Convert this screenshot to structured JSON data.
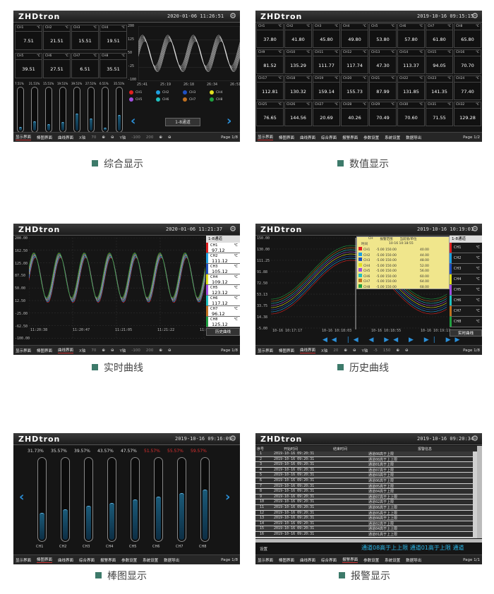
{
  "brand": "ZHDtron",
  "nav_tabs": [
    "显示界面",
    "棒图界面",
    "曲线界面",
    "综合界面",
    "报警界面",
    "参数设置",
    "系统设置",
    "数据导出"
  ],
  "panels": {
    "p1": {
      "caption": "综合显示",
      "datetime": "2020-01-06  11:26:51",
      "channels": [
        {
          "name": "CH1",
          "unit": "℃",
          "value": "7.51"
        },
        {
          "name": "CH2",
          "unit": "℃",
          "value": "21.51"
        },
        {
          "name": "CH3",
          "unit": "℃",
          "value": "15.51"
        },
        {
          "name": "CH4",
          "unit": "℃",
          "value": "19.51"
        },
        {
          "name": "CH5",
          "unit": "℃",
          "value": "39.51"
        },
        {
          "name": "CH6",
          "unit": "℃",
          "value": "27.51"
        },
        {
          "name": "CH7",
          "unit": "℃",
          "value": "6.51"
        },
        {
          "name": "CH8",
          "unit": "℃",
          "value": "35.51"
        }
      ],
      "bar_pcts": [
        "7.51%",
        "21.51%",
        "15.51%",
        "19.51%",
        "39.51%",
        "27.51%",
        "6.51%",
        "35.51%"
      ],
      "yticks": [
        "200",
        "125",
        "50",
        "-25",
        "-100"
      ],
      "xticks": [
        "25:41",
        "25:19",
        "26:18",
        "26:34",
        "26:51"
      ],
      "legend": [
        "CH1",
        "CH2",
        "CH3",
        "CH4",
        "CH5",
        "CH6",
        "CH7",
        "CH8"
      ],
      "group": "1-8通道",
      "footer": {
        "x": "X轴",
        "x_val": "70",
        "y": "Y轴",
        "y_min": "-100",
        "y_max": "200",
        "page": "Page 1/8"
      }
    },
    "p2": {
      "caption": "数值显示",
      "datetime": "2019-10-16  09:15:15",
      "rows": [
        [
          [
            "CH1",
            "37.80"
          ],
          [
            "CH2",
            "41.80"
          ],
          [
            "CH3",
            "45.80"
          ],
          [
            "CH4",
            "49.80"
          ],
          [
            "CH5",
            "53.80"
          ],
          [
            "CH6",
            "57.80"
          ],
          [
            "CH7",
            "61.80"
          ],
          [
            "CH8",
            "65.80"
          ]
        ],
        [
          [
            "CH9",
            "81.52"
          ],
          [
            "CH10",
            "135.29"
          ],
          [
            "CH11",
            "111.77"
          ],
          [
            "CH12",
            "117.74"
          ],
          [
            "CH13",
            "47.30"
          ],
          [
            "CH14",
            "113.37"
          ],
          [
            "CH15",
            "94.05"
          ],
          [
            "CH16",
            "70.70"
          ]
        ],
        [
          [
            "CH17",
            "112.81"
          ],
          [
            "CH18",
            "130.32"
          ],
          [
            "CH19",
            "159.14"
          ],
          [
            "CH20",
            "155.73"
          ],
          [
            "CH21",
            "87.99"
          ],
          [
            "CH22",
            "131.85"
          ],
          [
            "CH23",
            "141.35"
          ],
          [
            "CH24",
            "77.40"
          ]
        ],
        [
          [
            "CH25",
            "76.65"
          ],
          [
            "CH26",
            "144.56"
          ],
          [
            "CH27",
            "20.69"
          ],
          [
            "CH28",
            "40.26"
          ],
          [
            "CH29",
            "70.49"
          ],
          [
            "CH30",
            "70.60"
          ],
          [
            "CH31",
            "71.55"
          ],
          [
            "CH32",
            "129.28"
          ]
        ]
      ],
      "unit": "℃",
      "page": "Page 1/2"
    },
    "p3": {
      "caption": "实时曲线",
      "datetime": "2020-01-06  11:21:37",
      "yticks": [
        "200.00",
        "162.50",
        "125.00",
        "87.50",
        "50.00",
        "12.50",
        "-25.00",
        "-62.50",
        "-100.00"
      ],
      "xticks": [
        "11:20:38",
        "11:20:47",
        "11:21:05",
        "11:21:22",
        "11:21:40"
      ],
      "group": "1-8通道",
      "channels": [
        {
          "name": "CH1",
          "value": "97.12",
          "color": "#e02020"
        },
        {
          "name": "CH2",
          "value": "111.12",
          "color": "#20a0e0"
        },
        {
          "name": "CH3",
          "value": "105.12",
          "color": "#2050c0"
        },
        {
          "name": "CH4",
          "value": "109.12",
          "color": "#e0e020"
        },
        {
          "name": "CH5",
          "value": "123.12",
          "color": "#a050e0"
        },
        {
          "name": "CH6",
          "value": "117.12",
          "color": "#20c0c0"
        },
        {
          "name": "CH7",
          "value": "96.12",
          "color": "#c07020"
        },
        {
          "name": "CH8",
          "value": "125.12",
          "color": "#20a040"
        }
      ],
      "unit": "℃",
      "hist_btn": "历史曲线",
      "footer": {
        "x": "X轴",
        "x_val": "70",
        "y": "Y轴",
        "y_min": "-100",
        "y_max": "200",
        "page": "Page 1/8"
      }
    },
    "p4": {
      "caption": "历史曲线",
      "datetime": "2019-10-16  10:19:01",
      "yticks": [
        "150.00",
        "130.00",
        "111.25",
        "91.88",
        "72.50",
        "53.13",
        "33.75",
        "14.38",
        "-5.00"
      ],
      "table_head": [
        "",
        "CH",
        "报警范围",
        "当前值/单位"
      ],
      "table_sub": [
        "时间",
        "10-16 10:18:55"
      ],
      "table_rows": [
        [
          "CH1",
          "-5.00 150.00",
          "40.00"
        ],
        [
          "CH2",
          "-5.00 150.00",
          "44.00"
        ],
        [
          "CH3",
          "-5.00 150.00",
          "48.00"
        ],
        [
          "CH4",
          "-5.00 150.00",
          "52.00"
        ],
        [
          "CH5",
          "-5.00 150.00",
          "56.00"
        ],
        [
          "CH6",
          "-5.00 150.00",
          "60.00"
        ],
        [
          "CH7",
          "-5.00 150.00",
          "64.00"
        ],
        [
          "CH8",
          "-5.00 150.00",
          "68.00"
        ]
      ],
      "row_colors": [
        "#e02020",
        "#20a0e0",
        "#2050c0",
        "#e0e020",
        "#a050e0",
        "#20c0c0",
        "#c07020",
        "#20a040"
      ],
      "xticks": [
        "10-16 10:17:17",
        "10-16 10:18:03",
        "10-16 10:18:55",
        "10-16 10:19:17"
      ],
      "group": "1-8通道",
      "chs": [
        "CH1",
        "CH2",
        "CH3",
        "CH4",
        "CH5",
        "CH6",
        "CH7",
        "CH8"
      ],
      "unit": "℃",
      "hist_btn": "实时曲线",
      "footer": {
        "x": "X轴",
        "x_val": "20",
        "y": "Y轴",
        "y_min": "-5",
        "y_max": "150",
        "page": "Page 1/8"
      }
    },
    "p5": {
      "caption": "棒图显示",
      "datetime": "2019-10-16  09:16:09",
      "pcts": [
        "31.73%",
        "35.57%",
        "39.57%",
        "43.57%",
        "47.57%",
        "51.57%",
        "55.57%",
        "59.57%"
      ],
      "over_color": "#e03030",
      "names": [
        "CH1",
        "CH2",
        "CH3",
        "CH4",
        "CH5",
        "CH6",
        "CH7",
        "CH8"
      ],
      "levels": [
        0.33,
        0.37,
        0.41,
        0.45,
        0.49,
        0.53,
        0.57,
        0.61
      ],
      "page": "Page 1/8"
    },
    "p6": {
      "caption": "报警显示",
      "datetime": "2019-10-16  09:20:34",
      "head": [
        "序号",
        "开始时间",
        "结束时间",
        "报警信息"
      ],
      "rows": [
        [
          "1",
          "2019-10-16 09:20:31",
          "",
          "通道08高于上限"
        ],
        [
          "2",
          "2019-10-16 09:20:31",
          "",
          "通道08高于上上限"
        ],
        [
          "3",
          "2019-10-16 09:20:31",
          "",
          "通道01高于上限"
        ],
        [
          "4",
          "2019-10-16 09:20:31",
          "",
          "通道07高于上限"
        ],
        [
          "5",
          "2019-10-16 09:20:31",
          "",
          "通道03高于上限"
        ],
        [
          "6",
          "2019-10-16 09:20:31",
          "",
          "通道06高于上限"
        ],
        [
          "7",
          "2019-10-16 09:20:31",
          "",
          "通道05高于上限"
        ],
        [
          "8",
          "2019-10-16 09:20:31",
          "",
          "通道04高于上限"
        ],
        [
          "9",
          "2019-10-16 09:20:31",
          "",
          "通道07高于上上限"
        ],
        [
          "10",
          "2019-10-16 09:20:31",
          "",
          "通道02高于上限"
        ],
        [
          "11",
          "2019-10-16 09:20:31",
          "",
          "通道06高于上上限"
        ],
        [
          "12",
          "2019-10-16 09:20:31",
          "",
          "通道05高于上上限"
        ],
        [
          "13",
          "2019-10-16 09:20:31",
          "",
          "通道08高于上上限"
        ],
        [
          "14",
          "2019-10-16 09:20:31",
          "",
          "通道02高于上限"
        ],
        [
          "15",
          "2019-10-16 09:20:31",
          "",
          "通道04高于上上限"
        ],
        [
          "16",
          "2019-10-16 09:20:31",
          "",
          "通道01高于上上限"
        ]
      ],
      "settings": "设置",
      "ticker": "通道08高于上上限  通道01高于上限  通道",
      "page": "Page 1/1"
    }
  }
}
